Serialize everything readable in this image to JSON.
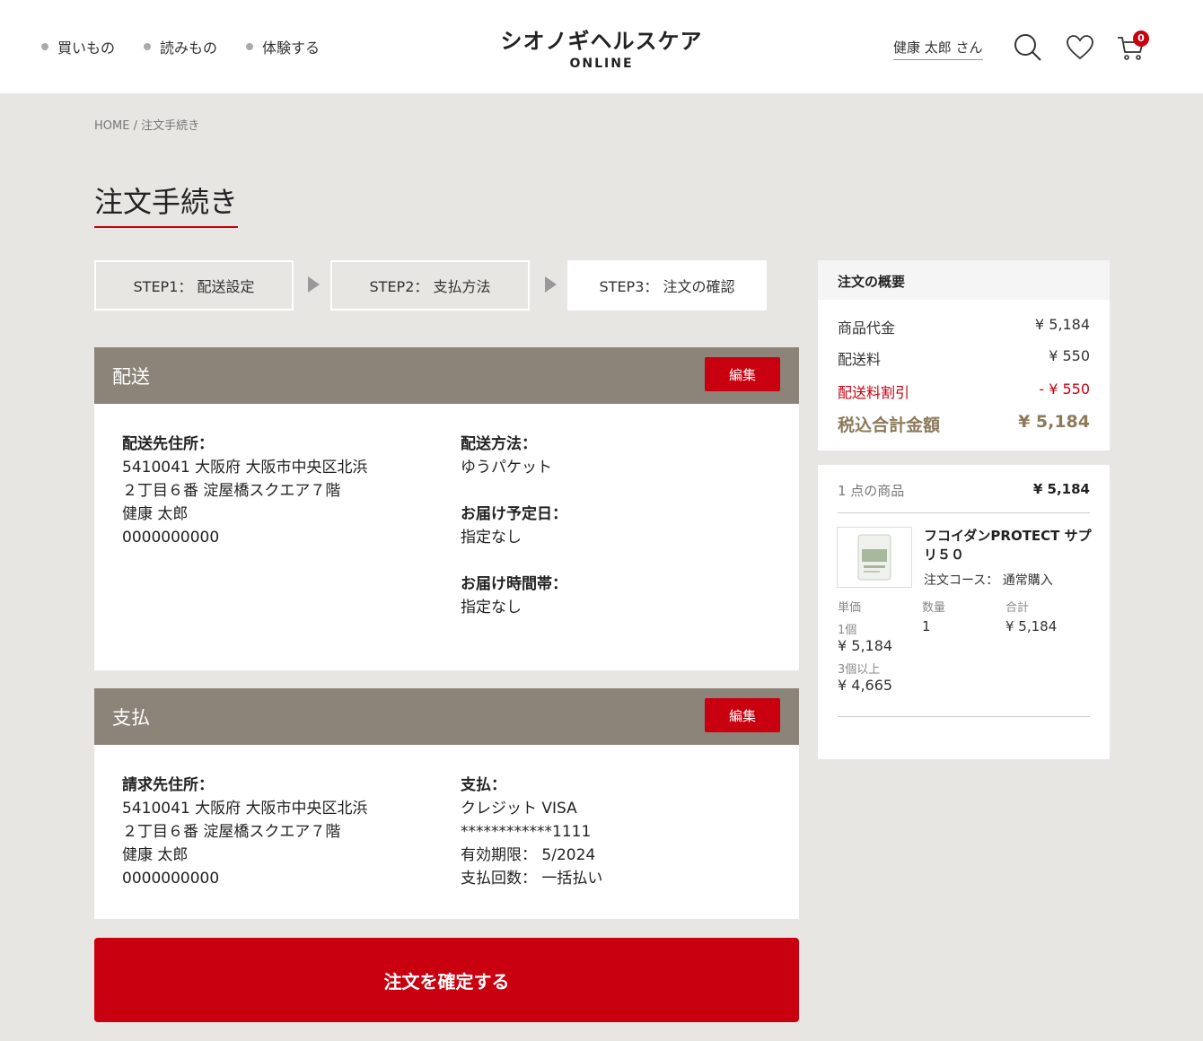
{
  "nav": {
    "items": [
      "買いもの",
      "読みもの",
      "体験する"
    ]
  },
  "logo": {
    "main": "シオノギヘルスケア",
    "sub": "ONLINE"
  },
  "header": {
    "user": "健康 太郎 さん",
    "cart_count": "0"
  },
  "breadcrumb": "HOME / 注文手続き",
  "page_title": "注文手続き",
  "steps": [
    "STEP1： 配送設定",
    "STEP2： 支払方法",
    "STEP3： 注文の確認"
  ],
  "shipping": {
    "title": "配送",
    "edit": "編集",
    "address_label": "配送先住所：",
    "address_lines": [
      "5410041 大阪府 大阪市中央区北浜",
      "２丁目６番 淀屋橋スクエア７階",
      "健康 太郎",
      "0000000000"
    ],
    "method_label": "配送方法：",
    "method": "ゆうパケット",
    "date_label": "お届け予定日：",
    "date": "指定なし",
    "time_label": "お届け時間帯：",
    "time": "指定なし"
  },
  "payment": {
    "title": "支払",
    "edit": "編集",
    "address_label": "請求先住所：",
    "address_lines": [
      "5410041 大阪府 大阪市中央区北浜",
      "２丁目６番 淀屋橋スクエア７階",
      "健康 太郎",
      "0000000000"
    ],
    "pay_label": "支払：",
    "card": "クレジット VISA",
    "card_number": "************1111",
    "expiry": "有効期限： 5/2024",
    "installments": "支払回数： 一括払い"
  },
  "confirm_button": "注文を確定する",
  "summary": {
    "title": "注文の概要",
    "subtotal_label": "商品代金",
    "subtotal": "¥ 5,184",
    "shipping_label": "配送料",
    "shipping": "¥ 550",
    "discount_label": "配送料割引",
    "discount": "- ¥ 550",
    "total_label": "税込合計金額",
    "total": "¥ 5,184"
  },
  "items": {
    "count": "1 点の商品",
    "sum": "¥ 5,184",
    "product_name": "フコイダンPROTECT サプリ５０",
    "course": "注文コース： 通常購入",
    "unit_header": "単価",
    "qty_header": "数量",
    "total_header": "合計",
    "unit_tier1_label": "1個",
    "unit_tier1_price": "¥ 5,184",
    "unit_tier2_label": "3個以上",
    "unit_tier2_price": "¥ 4,665",
    "qty": "1",
    "line_total": "¥ 5,184"
  }
}
